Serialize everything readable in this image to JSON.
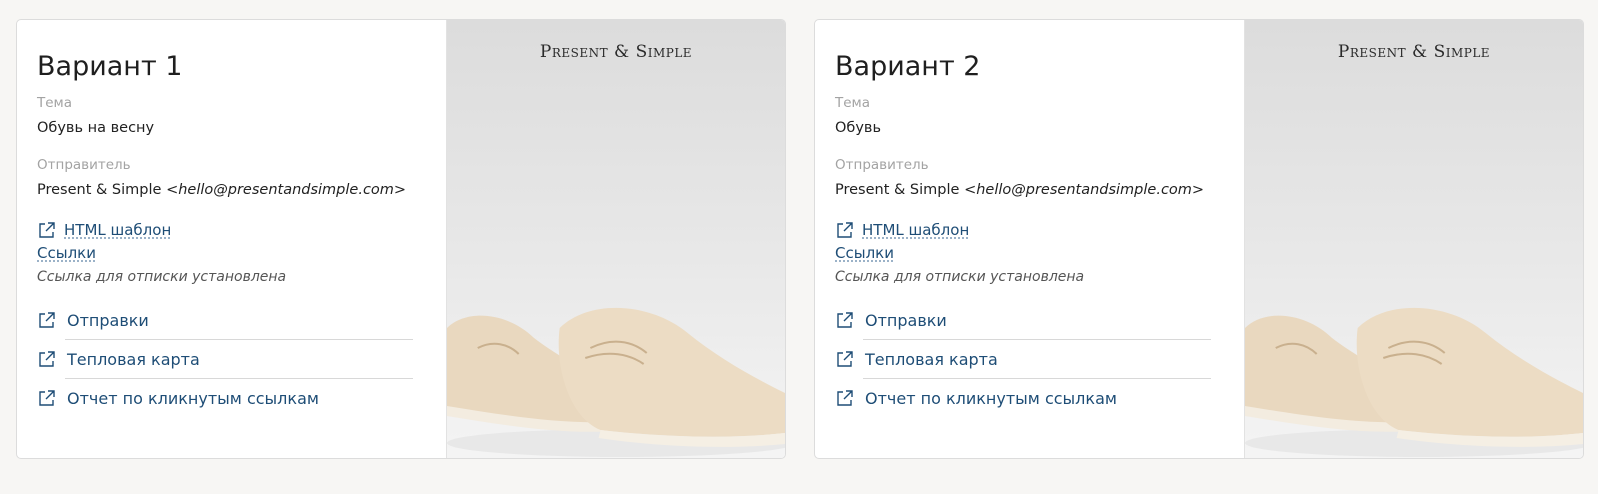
{
  "variants": [
    {
      "title": "Вариант 1",
      "subject_label": "Тема",
      "subject": "Обувь на весну",
      "sender_label": "Отправитель",
      "sender_name": "Present & Simple",
      "sender_email": "<hello@presentandsimple.com>",
      "html_template": "HTML шаблон",
      "links": "Ссылки",
      "unsubscribe_note": "Ссылка для отписки установлена",
      "actions": [
        "Отправки",
        "Тепловая карта",
        "Отчет по кликнутым ссылкам"
      ],
      "brand": "Present & Simple"
    },
    {
      "title": "Вариант 2",
      "subject_label": "Тема",
      "subject": "Обувь",
      "sender_label": "Отправитель",
      "sender_name": "Present & Simple",
      "sender_email": "<hello@presentandsimple.com>",
      "html_template": "HTML шаблон",
      "links": "Ссылки",
      "unsubscribe_note": "Ссылка для отписки установлена",
      "actions": [
        "Отправки",
        "Тепловая карта",
        "Отчет по кликнутым ссылкам"
      ],
      "brand": "Present & Simple"
    }
  ],
  "icons": {
    "external": "external-link-icon"
  },
  "colors": {
    "link": "#1e4d76",
    "muted": "#a3a3a3",
    "background": "#f7f6f4"
  }
}
